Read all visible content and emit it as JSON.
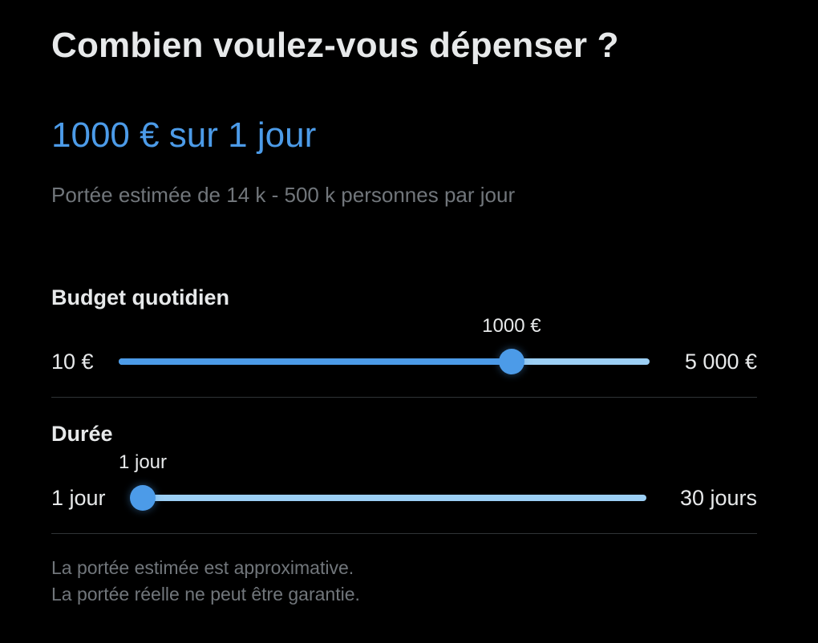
{
  "header": {
    "title": "Combien voulez-vous dépenser ?"
  },
  "summary": {
    "text": "1000 € sur 1 jour",
    "color": "#4c9be8"
  },
  "reach": {
    "text": "Portée estimée de 14 k - 500 k personnes par jour"
  },
  "budget": {
    "label": "Budget quotidien",
    "min_label": "10 €",
    "max_label": "5 000 €",
    "value_label": "1000 €",
    "min": 10,
    "max": 5000,
    "value": 1000,
    "position_fraction": 0.74
  },
  "duration": {
    "label": "Durée",
    "min_label": "1 jour",
    "max_label": "30 jours",
    "value_label": "1 jour",
    "min": 1,
    "max": 30,
    "value": 1,
    "position_fraction": 0.0
  },
  "disclaimer": {
    "line1": "La portée estimée est approximative.",
    "line2": "La portée réelle ne peut être garantie."
  },
  "colors": {
    "accent": "#4c9be8",
    "track_light": "#9ccff5",
    "muted_text": "#71767b",
    "primary_text": "#e7e9ea",
    "background": "#000000",
    "divider": "#2f3336"
  }
}
